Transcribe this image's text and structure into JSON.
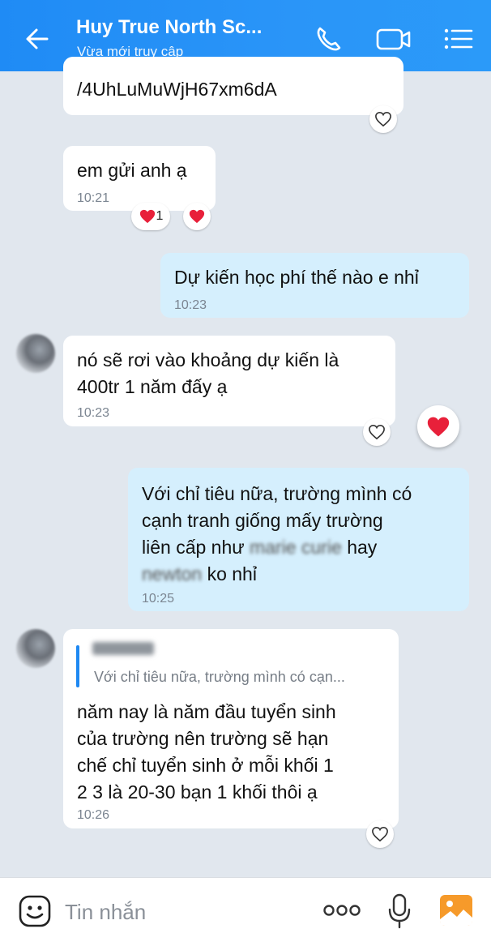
{
  "header": {
    "title": "Huy True North Sc...",
    "subtitle": "Vừa mới truy cập",
    "icons": [
      "back-arrow-icon",
      "phone-icon",
      "video-call-icon",
      "menu-icon"
    ]
  },
  "messages": [
    {
      "side": "in",
      "text": "/4UhLuMuWjH67xm6dA",
      "time": ""
    },
    {
      "side": "in",
      "text": "em gửi anh ạ",
      "time": "10:21",
      "reaction_count": "1"
    },
    {
      "side": "out",
      "text": "Dự kiến học phí thế nào e nhỉ",
      "time": "10:23"
    },
    {
      "side": "in",
      "text": "nó sẽ rơi vào khoảng dự kiến là\n400tr 1 năm đấy ạ",
      "time": "10:23"
    },
    {
      "side": "out",
      "lines": [
        "Với chỉ tiêu nữa, trường mình có",
        "cạnh tranh giống mấy trường",
        "liên cấp như",
        "hay",
        "ko nhỉ"
      ],
      "blurred": [
        "marie curie",
        "newton"
      ],
      "time": "10:25"
    },
    {
      "side": "in",
      "quote": "Với chỉ tiêu nữa, trường mình có cạn...",
      "text": "năm nay là năm đầu tuyển sinh\ncủa trường nên trường sẽ hạn\nchế chỉ tuyển sinh ở mỗi khối 1\n2 3 là 20-30 bạn 1 khối thôi ạ",
      "time": "10:26"
    }
  ],
  "footer": {
    "placeholder": "Tin nhắn",
    "icons": [
      "sticker-icon",
      "more-dots-icon",
      "microphone-icon",
      "image-icon"
    ]
  },
  "colors": {
    "header": "#2a95f8",
    "outgoing": "#d5effd",
    "incoming": "#ffffff",
    "background": "#e1e7ee",
    "heart": "#e8203a"
  }
}
